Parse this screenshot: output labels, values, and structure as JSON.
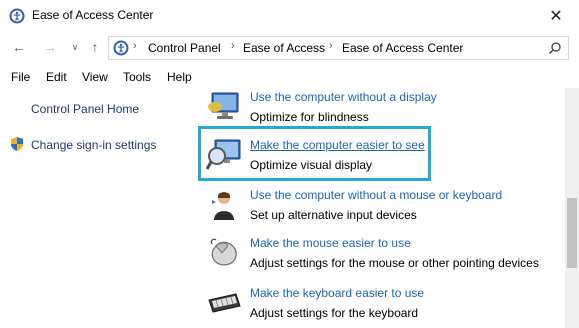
{
  "window": {
    "title": "Ease of Access Center",
    "close_glyph": "✕"
  },
  "nav": {
    "back_glyph": "←",
    "forward_glyph": "→",
    "dropdown_glyph": "∨",
    "up_glyph": "↑",
    "breadcrumbs": [
      "Control Panel",
      "Ease of Access",
      "Ease of Access Center"
    ],
    "separator": "›"
  },
  "menu": [
    "File",
    "Edit",
    "View",
    "Tools",
    "Help"
  ],
  "sidebar": {
    "home": "Control Panel Home",
    "signin": "Change sign-in settings"
  },
  "items": [
    {
      "link": "Use the computer without a display",
      "desc": "Optimize for blindness",
      "icon": "monitor-icon"
    },
    {
      "link": "Make the computer easier to see",
      "desc": "Optimize visual display",
      "icon": "magnifier-monitor-icon"
    },
    {
      "link": "Use the computer without a mouse or keyboard",
      "desc": "Set up alternative input devices",
      "icon": "person-speaking-icon"
    },
    {
      "link": "Make the mouse easier to use",
      "desc": "Adjust settings for the mouse or other pointing devices",
      "icon": "mouse-icon"
    },
    {
      "link": "Make the keyboard easier to use",
      "desc": "Adjust settings for the keyboard",
      "icon": "keyboard-icon"
    }
  ],
  "colors": {
    "link": "#1c67b5",
    "highlight_border": "#24a8d6"
  }
}
